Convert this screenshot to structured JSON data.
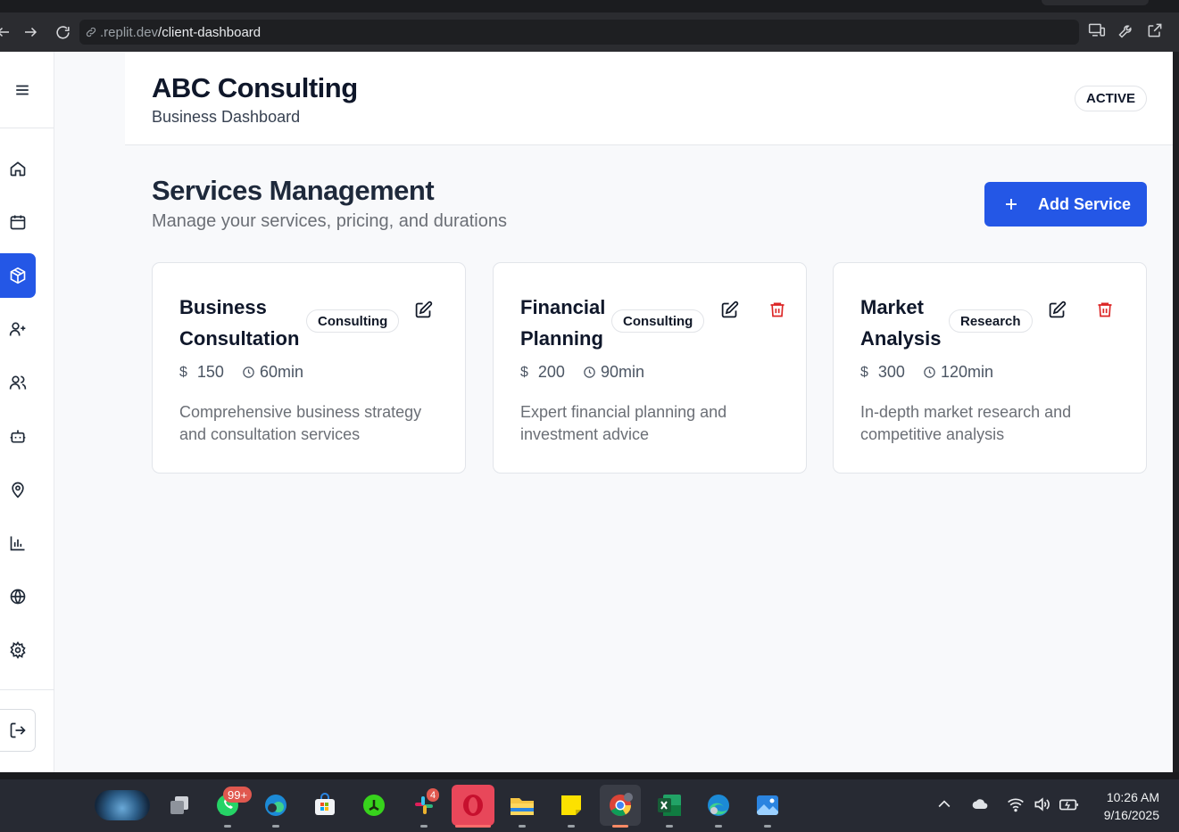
{
  "browser": {
    "url_host": ".replit.dev",
    "url_path": "/client-dashboard"
  },
  "header": {
    "title": "ABC Consulting",
    "subtitle": "Business Dashboard",
    "status": "ACTIVE"
  },
  "sidebar": {
    "items": [
      {
        "icon": "home-icon"
      },
      {
        "icon": "calendar-icon"
      },
      {
        "icon": "package-icon",
        "active": true
      },
      {
        "icon": "user-plus-icon"
      },
      {
        "icon": "users-icon"
      },
      {
        "icon": "bot-icon"
      },
      {
        "icon": "map-pin-icon"
      },
      {
        "icon": "bar-chart-icon"
      },
      {
        "icon": "globe-icon"
      },
      {
        "icon": "settings-icon"
      }
    ],
    "logout_icon": "logout-icon"
  },
  "main": {
    "title": "Services Management",
    "subtitle": "Manage your services, pricing, and durations",
    "add_button": "Add Service",
    "services": [
      {
        "name_line1": "Business",
        "name_line2": "Consultation",
        "category": "Consulting",
        "price": "150",
        "duration": "60min",
        "description": "Comprehensive business strategy and consultation services",
        "deletable": false
      },
      {
        "name_line1": "Financial",
        "name_line2": "Planning",
        "category": "Consulting",
        "price": "200",
        "duration": "90min",
        "description": "Expert financial planning and investment advice",
        "deletable": true
      },
      {
        "name_line1": "Market",
        "name_line2": "Analysis",
        "category": "Research",
        "price": "300",
        "duration": "120min",
        "description": "In-depth market research and competitive analysis",
        "deletable": true
      }
    ]
  },
  "taskbar": {
    "whatsapp_badge": "99+",
    "slack_badge": "4",
    "time": "10:26 AM",
    "date": "9/16/2025"
  },
  "colors": {
    "accent": "#2457e6",
    "danger": "#dc2626"
  }
}
